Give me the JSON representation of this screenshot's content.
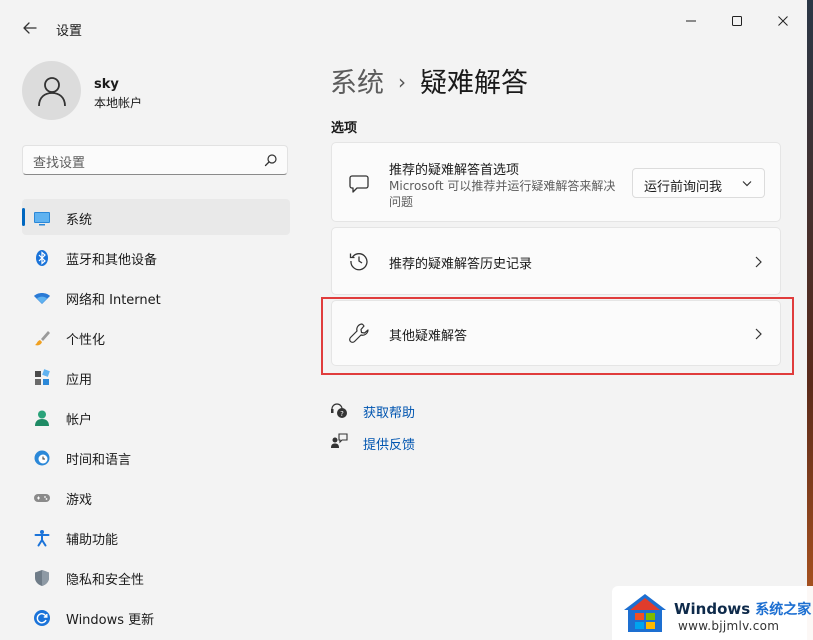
{
  "window": {
    "title": "设置",
    "back_icon": "arrow-left-icon",
    "controls": [
      "minimize-icon",
      "maximize-icon",
      "close-icon"
    ]
  },
  "user": {
    "name": "sky",
    "account_type": "本地帐户",
    "avatar_icon": "person-icon"
  },
  "search": {
    "placeholder": "查找设置",
    "icon": "search-icon"
  },
  "sidebar": {
    "items": [
      {
        "label": "系统",
        "icon": "monitor-icon",
        "selected": true
      },
      {
        "label": "蓝牙和其他设备",
        "icon": "bluetooth-icon"
      },
      {
        "label": "网络和 Internet",
        "icon": "wifi-icon"
      },
      {
        "label": "个性化",
        "icon": "brush-icon"
      },
      {
        "label": "应用",
        "icon": "apps-icon"
      },
      {
        "label": "帐户",
        "icon": "person-icon"
      },
      {
        "label": "时间和语言",
        "icon": "clock-globe-icon"
      },
      {
        "label": "游戏",
        "icon": "gamepad-icon"
      },
      {
        "label": "辅助功能",
        "icon": "accessibility-icon"
      },
      {
        "label": "隐私和安全性",
        "icon": "shield-icon"
      },
      {
        "label": "Windows 更新",
        "icon": "update-icon"
      }
    ]
  },
  "header": {
    "parent": "系统",
    "separator": "›",
    "current": "疑难解答"
  },
  "main": {
    "section_label": "选项",
    "cards": [
      {
        "title": "推荐的疑难解答首选项",
        "description": "Microsoft 可以推荐并运行疑难解答来解决问题",
        "icon": "chat-bubble-icon",
        "dropdown_value": "运行前询问我"
      },
      {
        "title": "推荐的疑难解答历史记录",
        "icon": "history-icon"
      },
      {
        "title": "其他疑难解答",
        "icon": "wrench-icon",
        "highlighted": true
      }
    ],
    "links": [
      {
        "label": "获取帮助",
        "icon": "help-icon"
      },
      {
        "label": "提供反馈",
        "icon": "feedback-icon"
      }
    ]
  },
  "watermark": {
    "brand": "Windows",
    "brand_cn": "系统之家",
    "url": "www.bjjmlv.com"
  },
  "colors": {
    "accent": "#0067c0",
    "link": "#0055b0",
    "highlight_border": "#e03c3c",
    "window_bg": "#f3f3f3",
    "card_bg": "#fbfbfb"
  }
}
